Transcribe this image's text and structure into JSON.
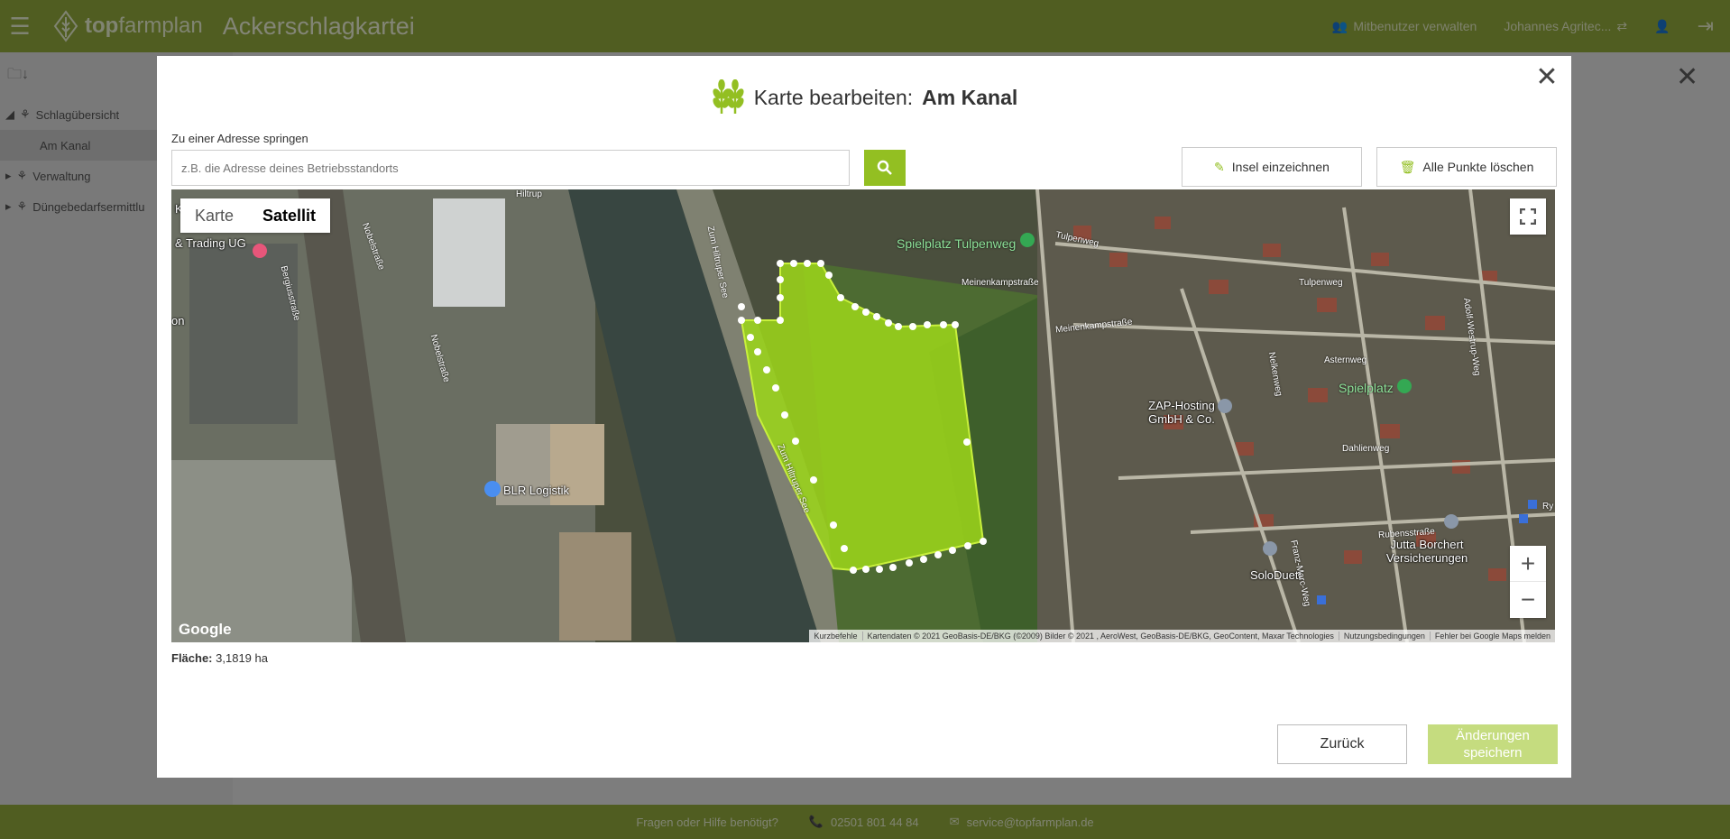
{
  "header": {
    "brand_prefix": "top",
    "brand_suffix": "farmplan",
    "app_title": "Ackerschlagkartei",
    "co_users": "Mitbenutzer verwalten",
    "user_name": "Johannes Agritec..."
  },
  "sidebar": {
    "items": [
      {
        "label": "Schlagübersicht"
      },
      {
        "label": "Am Kanal"
      },
      {
        "label": "Verwaltung"
      },
      {
        "label": "Düngebedarfsermittlu"
      }
    ]
  },
  "footer": {
    "help": "Fragen oder Hilfe benötigt?",
    "phone": "02501 801 44 84",
    "email": "service@topfarmplan.de"
  },
  "modal": {
    "title_prefix": "Karte bearbeiten:",
    "title_field": "Am Kanal",
    "address_label": "Zu einer Adresse springen",
    "address_placeholder": "z.B. die Adresse deines Betriebsstandorts",
    "draw_island": "Insel einzeichnen",
    "delete_points": "Alle Punkte löschen",
    "area_label": "Fläche:",
    "area_value": "3,1819 ha",
    "back": "Zurück",
    "save": "Änderungen speichern"
  },
  "map": {
    "type_map": "Karte",
    "type_satellite": "Satellit",
    "google": "Google",
    "shortcuts": "Kurzbefehle",
    "map_data": "Kartendaten © 2021 GeoBasis-DE/BKG (©2009) Bilder © 2021 , AeroWest, GeoBasis-DE/BKG, GeoContent, Maxar Technologies",
    "terms": "Nutzungsbedingungen",
    "report": "Fehler bei Google Maps melden",
    "labels": {
      "trading": "& Trading UG",
      "blr": "BLR Logistik",
      "spielplatz1": "Spielplatz Tulpenweg",
      "spielplatz2": "Spielplatz",
      "zap": "ZAP-Hosting GmbH & Co.",
      "soloduett": "SoloDuett",
      "jutta": "Jutta Borchert Versicherungen",
      "meinenkamp1": "Meinenkampstraße",
      "meinenkamp2": "Meinenkampstraße",
      "tulpenweg1": "Tulpenweg",
      "tulpenweg2": "Tulpenweg",
      "asternweg": "Asternweg",
      "dahlienweg": "Dahlienweg",
      "rubensstrasse": "Rubensstraße",
      "hiltruper1": "Zum Hiltruper See",
      "hiltruper2": "Zum Hiltruper See",
      "nobel1": "Nobelstraße",
      "nobel2": "Nobelstraße",
      "berg": "Bergiusstraße",
      "nelken": "Nelkenweg",
      "adolf": "Adolf-Westrup-Weg",
      "franz": "Franz-Marc-Weg",
      "on": "on",
      "k": "K",
      "hiltrup": "Hiltrup",
      "ry": "Ry"
    }
  },
  "colors": {
    "brand": "#93a93c",
    "field_fill": "#9bd41a",
    "save_disabled": "#c5dc7f"
  }
}
